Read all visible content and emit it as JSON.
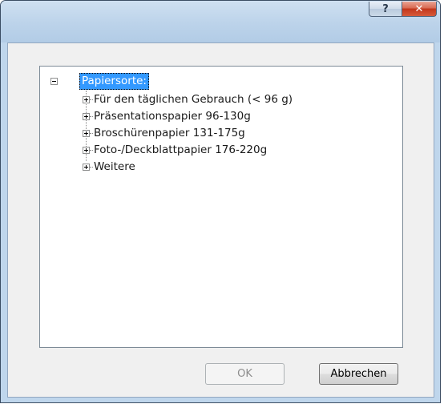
{
  "titlebar": {
    "help_label": "?",
    "close_label": "✕"
  },
  "tree": {
    "root_label": "Papiersorte:",
    "items": [
      {
        "label": "Für den täglichen Gebrauch (< 96 g)"
      },
      {
        "label": "Präsentationspapier 96-130g"
      },
      {
        "label": "Broschürenpapier 131-175g"
      },
      {
        "label": "Foto-/Deckblattpapier 176-220g"
      },
      {
        "label": "Weitere"
      }
    ]
  },
  "buttons": {
    "ok_label": "OK",
    "cancel_label": "Abbrechen"
  }
}
